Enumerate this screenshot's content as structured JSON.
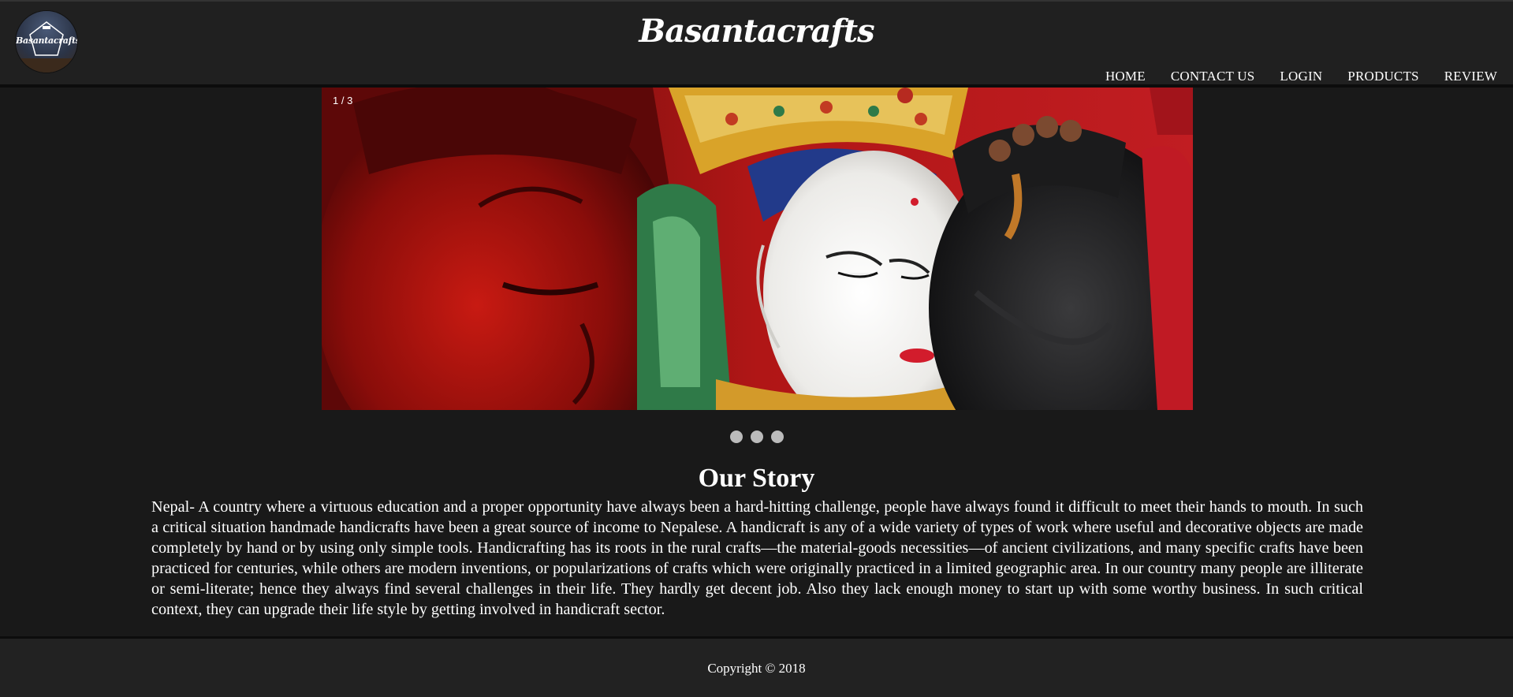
{
  "header": {
    "logo_text": "Basantacrafts",
    "site_title": "Basantacrafts",
    "nav": [
      "HOME",
      "CONTACT US",
      "LOGIN",
      "PRODUCTS",
      "REVIEW"
    ]
  },
  "slideshow": {
    "counter": "1 / 3",
    "current": 1,
    "total": 3
  },
  "story": {
    "title": "Our Story",
    "text": "Nepal- A country where a virtuous education and a proper opportunity have always been a hard-hitting challenge, people have always found it difficult to meet their hands to mouth. In such a critical situation handmade handicrafts have been a great source of income to Nepalese. A handicraft is any of a wide variety of types of work where useful and decorative objects are made completely by hand or by using only simple tools. Handicrafting has its roots in the rural crafts—the material-goods necessities—of ancient civilizations, and many specific crafts have been practiced for centuries, while others are modern inventions, or popularizations of crafts which were originally practiced in a limited geographic area. In our country many people are illiterate or semi-literate; hence they always find several challenges in their life. They hardly get decent job. Also they lack enough money to start up with some worthy business. In such critical context, they can upgrade their life style by getting involved in handicraft sector."
  },
  "footer": {
    "copyright": "Copyright © 2018"
  },
  "colors": {
    "background": "#191919",
    "header_bg": "#202020",
    "dot": "#bbbbbb"
  }
}
